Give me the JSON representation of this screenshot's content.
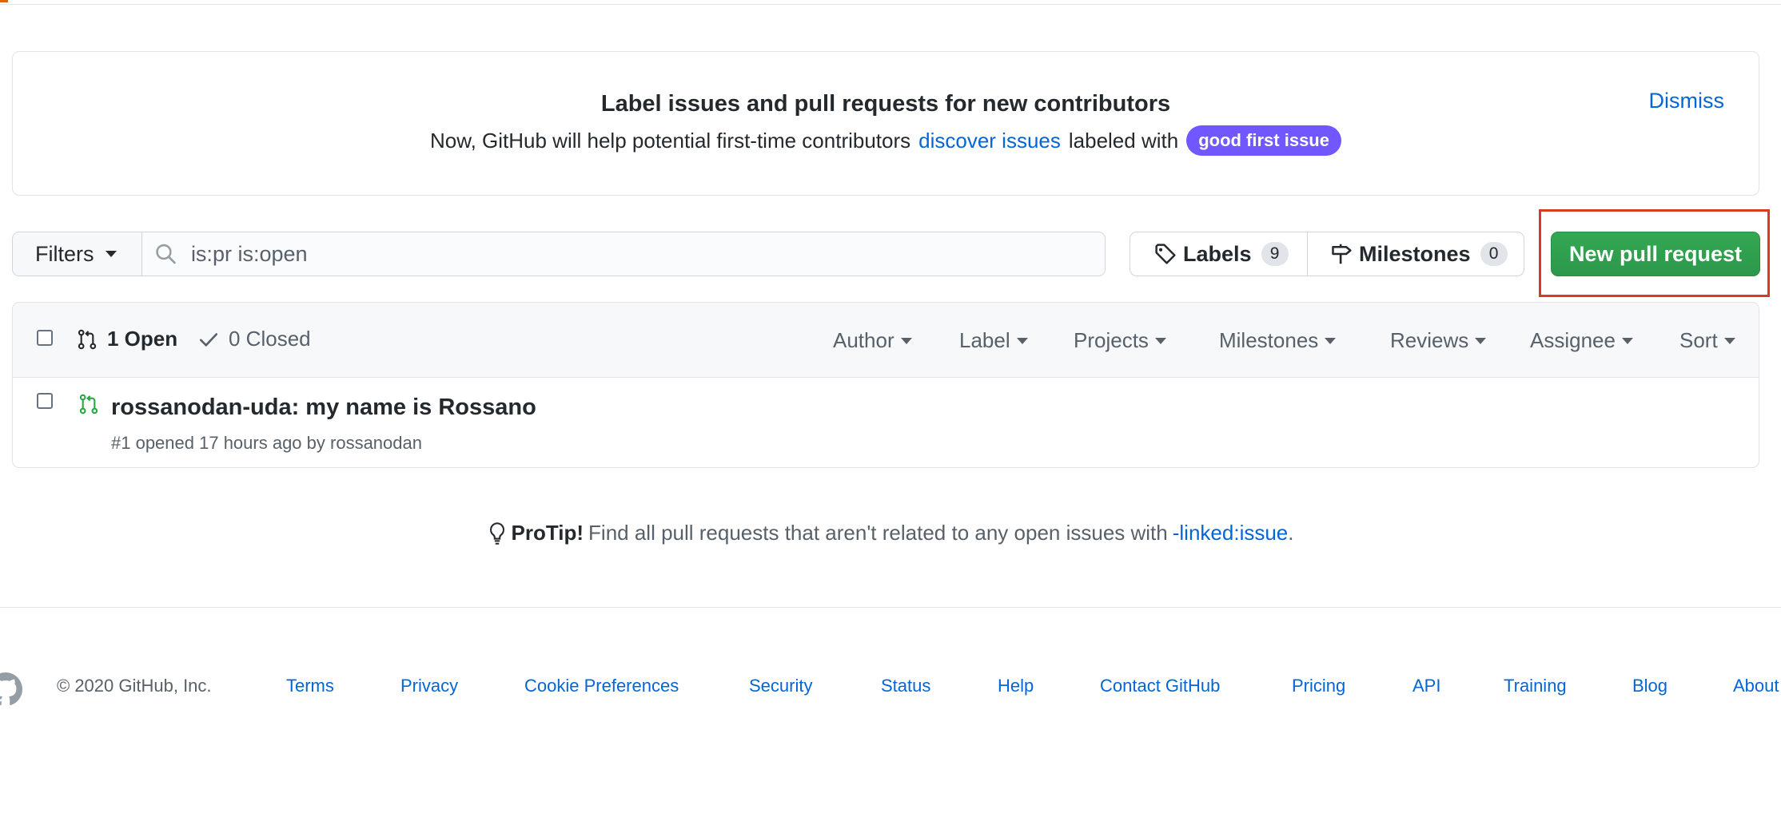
{
  "banner": {
    "title": "Label issues and pull requests for new contributors",
    "sub_before": "Now, GitHub will help potential first-time contributors",
    "sub_link": "discover issues",
    "sub_after": "labeled with",
    "badge": "good first issue",
    "badge_color": "#7057ff",
    "dismiss": "Dismiss"
  },
  "filterbar": {
    "filters_label": "Filters",
    "search_value": "is:pr is:open",
    "labels_label": "Labels",
    "labels_count": "9",
    "milestones_label": "Milestones",
    "milestones_count": "0",
    "new_pr_label": "New pull request",
    "new_pr_color": "#2c974b"
  },
  "issues": {
    "open_label": "1 Open",
    "closed_label": "0 Closed",
    "menus": [
      "Author",
      "Label",
      "Projects",
      "Milestones",
      "Reviews",
      "Assignee",
      "Sort"
    ],
    "rows": [
      {
        "title": "rossanodan-uda: my name is Rossano",
        "meta": "#1 opened 17 hours ago by rossanodan"
      }
    ]
  },
  "protip": {
    "label": "ProTip!",
    "text": "Find all pull requests that aren't related to any open issues with",
    "link": "-linked:issue",
    "end": "."
  },
  "footer": {
    "copyright": "© 2020 GitHub, Inc.",
    "links": [
      "Terms",
      "Privacy",
      "Cookie Preferences",
      "Security",
      "Status",
      "Help",
      "Contact GitHub",
      "Pricing",
      "API",
      "Training",
      "Blog",
      "About"
    ]
  }
}
